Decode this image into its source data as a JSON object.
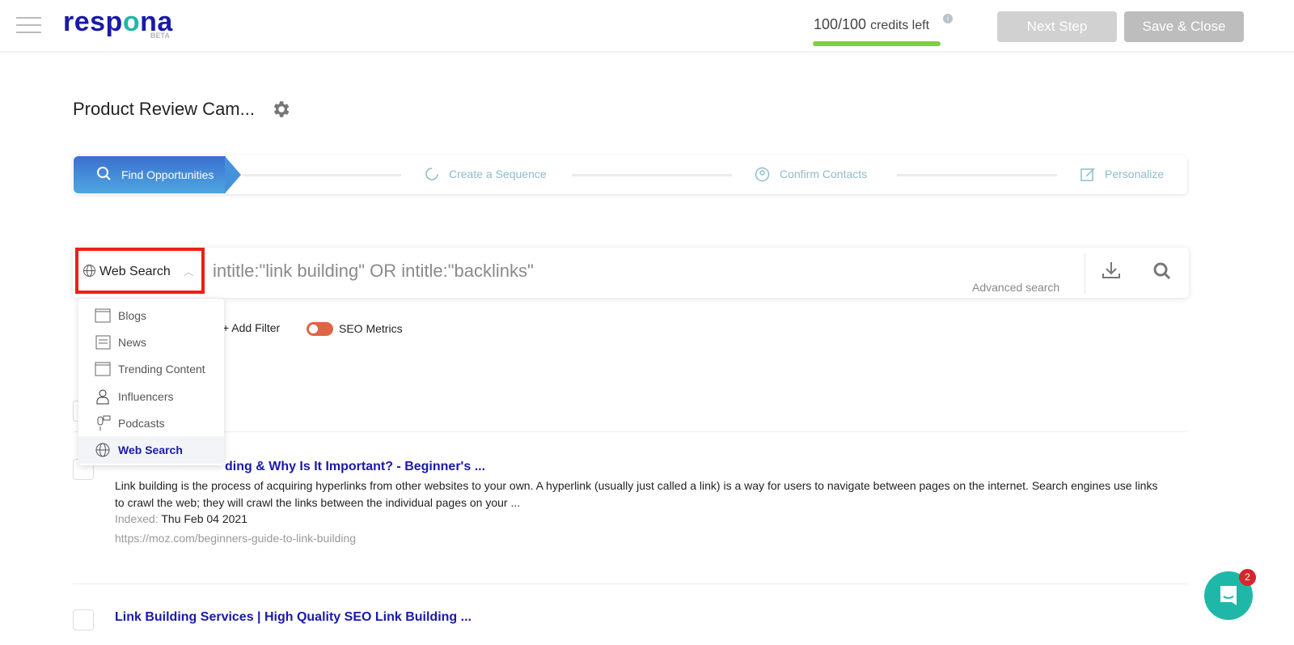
{
  "header": {
    "logo": "respona",
    "logo_badge": "BETA",
    "credits": "100/100",
    "credits_suffix": "credits left",
    "credits_fraction": 1.0,
    "next_step": "Next Step",
    "save_close": "Save & Close"
  },
  "campaign": {
    "title": "Product Review Cam..."
  },
  "steps": [
    {
      "label": "Find Opportunities",
      "active": true
    },
    {
      "label": "Create a Sequence"
    },
    {
      "label": "Confirm Contacts"
    },
    {
      "label": "Personalize"
    }
  ],
  "search": {
    "source_type": "Web Search",
    "query": "intitle:\"link building\" OR intitle:\"backlinks\"",
    "advanced": "Advanced search"
  },
  "source_menu": [
    {
      "label": "Blogs",
      "icon": "blog-icon"
    },
    {
      "label": "News",
      "icon": "news-icon"
    },
    {
      "label": "Trending Content",
      "icon": "blog-icon"
    },
    {
      "label": "Influencers",
      "icon": "person-icon"
    },
    {
      "label": "Podcasts",
      "icon": "microphone-icon"
    },
    {
      "label": "Web Search",
      "icon": "globe-icon",
      "selected": true
    }
  ],
  "filters": {
    "add_filter": "+ Add Filter",
    "seo_metrics": "SEO Metrics"
  },
  "results": [
    {
      "title": "ding & Why Is It Important? - Beginner's ...",
      "snippet": "Link building is the process of acquiring hyperlinks from other websites to your own. A hyperlink (usually just called a link) is a way for users to navigate between pages on the internet. Search engines use links to crawl the web; they will crawl the links between the individual pages on your ...",
      "indexed_label": "Indexed:",
      "indexed": "Thu Feb 04 2021",
      "url": "https://moz.com/beginners-guide-to-link-building"
    },
    {
      "title": "Link Building Services | High Quality SEO Link Building ..."
    }
  ],
  "chat": {
    "badge": "2"
  },
  "colors": {
    "brand": "#1a1aa8",
    "accent": "#1fb8a8",
    "highlight": "#f01d12",
    "toggle": "#dd6644",
    "credit_bar": "#7fcf3c"
  }
}
